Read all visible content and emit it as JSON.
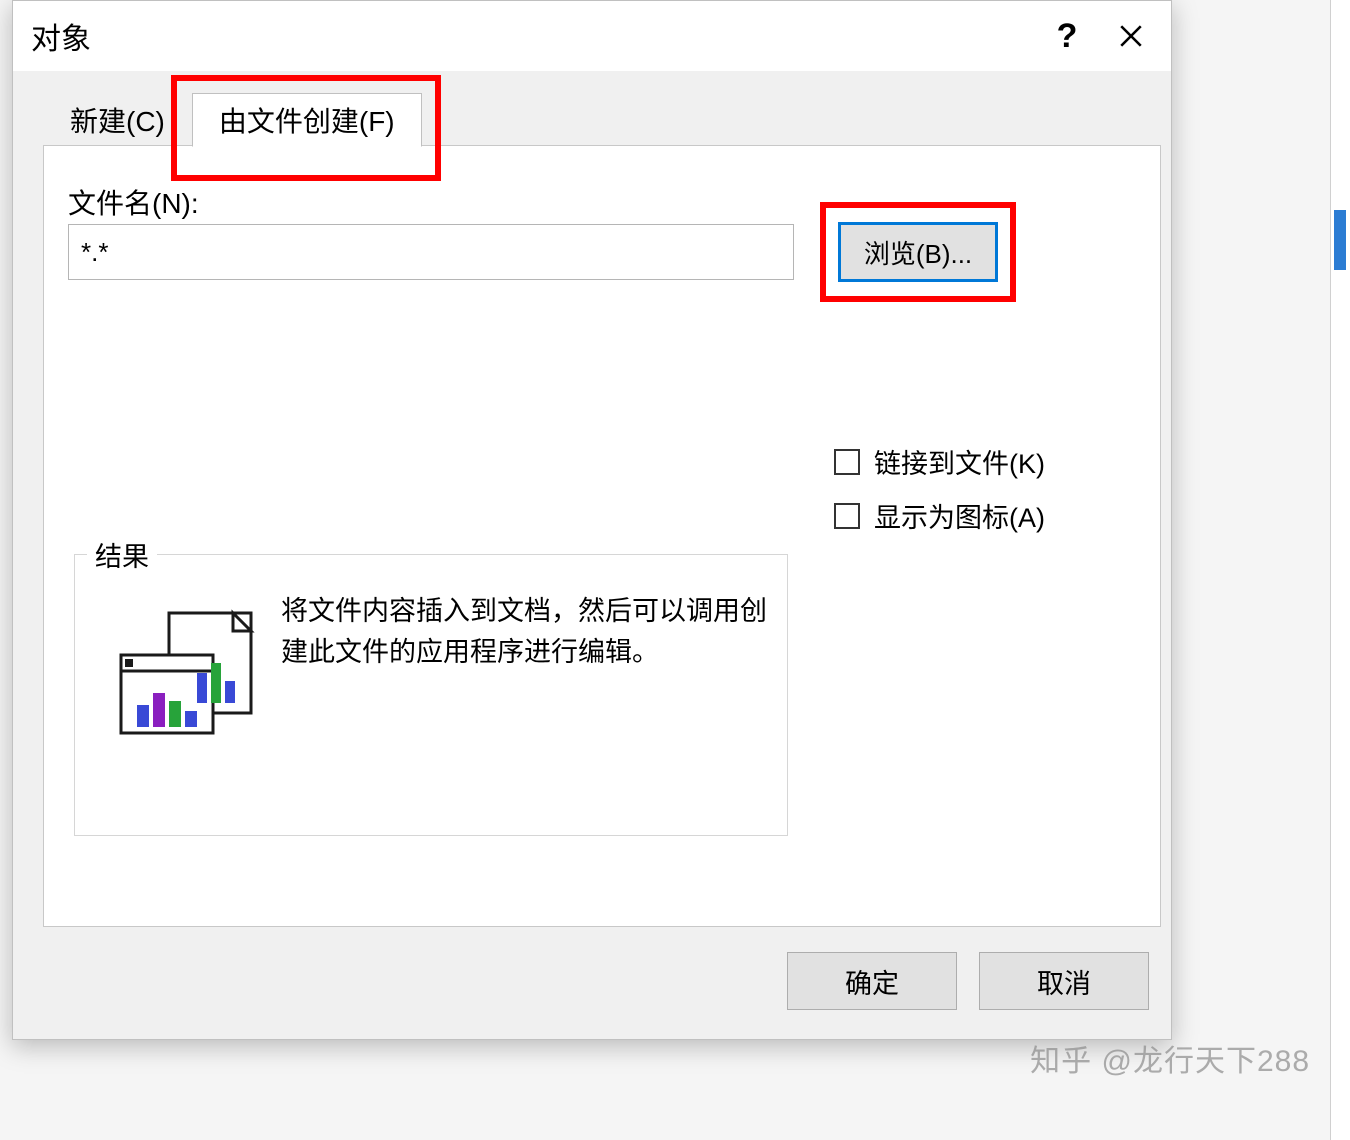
{
  "dialog": {
    "title": "对象",
    "help_tooltip": "?",
    "close_label": "×"
  },
  "tabs": {
    "new": "新建(C)",
    "from_file": "由文件创建(F)",
    "active": "from_file"
  },
  "filename": {
    "label": "文件名(N):",
    "value": "*.*"
  },
  "browse": {
    "label": "浏览(B)..."
  },
  "checkboxes": {
    "link_to_file": "链接到文件(K)",
    "display_as_icon": "显示为图标(A)"
  },
  "result": {
    "title": "结果",
    "description": "将文件内容插入到文档，然后可以调用创建此文件的应用程序进行编辑。"
  },
  "footer": {
    "ok": "确定",
    "cancel": "取消"
  },
  "watermark": "知乎 @龙行天下288"
}
